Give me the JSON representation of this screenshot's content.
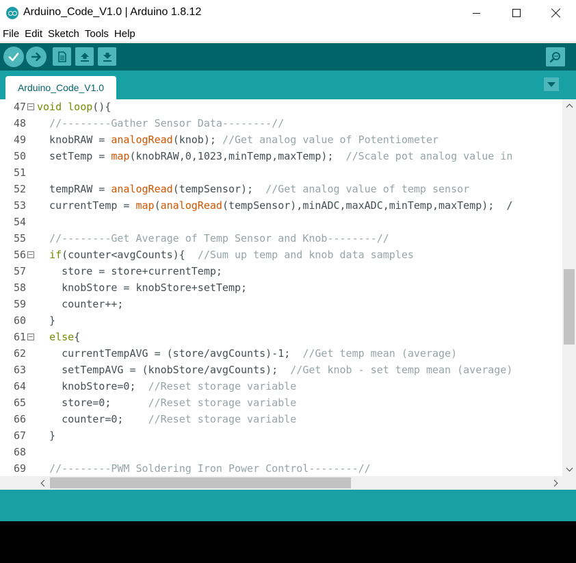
{
  "window": {
    "title": "Arduino_Code_V1.0 | Arduino 1.8.12",
    "app_icon": "arduino-logo-icon"
  },
  "menu": [
    "File",
    "Edit",
    "Sketch",
    "Tools",
    "Help"
  ],
  "toolbar": {
    "buttons": [
      "verify-icon",
      "upload-icon",
      "new-icon",
      "open-icon",
      "save-icon"
    ],
    "right_button": "serial-monitor-icon"
  },
  "tabs": [
    {
      "label": "Arduino_Code_V1.0",
      "active": true
    }
  ],
  "colors": {
    "toolbar": "#006468",
    "tabbar": "#17a1a5",
    "button": "#4db7bb",
    "keyword": "#728e00",
    "function": "#d35400",
    "comment": "#95a5a6",
    "text": "#434f54"
  },
  "editor": {
    "lines": [
      {
        "n": "47",
        "fold": true,
        "tokens": [
          {
            "t": "void loop",
            "c": "kw"
          },
          {
            "t": "(){",
            "c": ""
          }
        ]
      },
      {
        "n": "48",
        "fold": false,
        "tokens": [
          {
            "t": "  ",
            "c": ""
          },
          {
            "t": "//--------Gather Sensor Data--------//",
            "c": "cm"
          }
        ]
      },
      {
        "n": "49",
        "fold": false,
        "tokens": [
          {
            "t": "  knobRAW = ",
            "c": ""
          },
          {
            "t": "analogRead",
            "c": "fn"
          },
          {
            "t": "(knob); ",
            "c": ""
          },
          {
            "t": "//Get analog value of Potentiometer",
            "c": "cm"
          }
        ]
      },
      {
        "n": "50",
        "fold": false,
        "tokens": [
          {
            "t": "  setTemp = ",
            "c": ""
          },
          {
            "t": "map",
            "c": "fn"
          },
          {
            "t": "(knobRAW,0,1023,minTemp,maxTemp);  ",
            "c": ""
          },
          {
            "t": "//Scale pot analog value in",
            "c": "cm"
          }
        ]
      },
      {
        "n": "51",
        "fold": false,
        "tokens": []
      },
      {
        "n": "52",
        "fold": false,
        "tokens": [
          {
            "t": "  tempRAW = ",
            "c": ""
          },
          {
            "t": "analogRead",
            "c": "fn"
          },
          {
            "t": "(tempSensor);  ",
            "c": ""
          },
          {
            "t": "//Get analog value of temp sensor",
            "c": "cm"
          }
        ]
      },
      {
        "n": "53",
        "fold": false,
        "tokens": [
          {
            "t": "  currentTemp = ",
            "c": ""
          },
          {
            "t": "map",
            "c": "fn"
          },
          {
            "t": "(",
            "c": ""
          },
          {
            "t": "analogRead",
            "c": "fn"
          },
          {
            "t": "(tempSensor),minADC,maxADC,minTemp,maxTemp);  /",
            "c": ""
          }
        ]
      },
      {
        "n": "54",
        "fold": false,
        "tokens": []
      },
      {
        "n": "55",
        "fold": false,
        "tokens": [
          {
            "t": "  ",
            "c": ""
          },
          {
            "t": "//--------Get Average of Temp Sensor and Knob--------//",
            "c": "cm"
          }
        ]
      },
      {
        "n": "56",
        "fold": true,
        "tokens": [
          {
            "t": "  ",
            "c": ""
          },
          {
            "t": "if",
            "c": "kw"
          },
          {
            "t": "(counter<avgCounts){  ",
            "c": ""
          },
          {
            "t": "//Sum up temp and knob data samples",
            "c": "cm"
          }
        ]
      },
      {
        "n": "57",
        "fold": false,
        "tokens": [
          {
            "t": "    store = store+currentTemp;",
            "c": ""
          }
        ]
      },
      {
        "n": "58",
        "fold": false,
        "tokens": [
          {
            "t": "    knobStore = knobStore+setTemp;",
            "c": ""
          }
        ]
      },
      {
        "n": "59",
        "fold": false,
        "tokens": [
          {
            "t": "    counter++;",
            "c": ""
          }
        ]
      },
      {
        "n": "60",
        "fold": false,
        "tokens": [
          {
            "t": "  }",
            "c": ""
          }
        ]
      },
      {
        "n": "61",
        "fold": true,
        "tokens": [
          {
            "t": "  ",
            "c": ""
          },
          {
            "t": "else",
            "c": "kw"
          },
          {
            "t": "{",
            "c": ""
          }
        ]
      },
      {
        "n": "62",
        "fold": false,
        "tokens": [
          {
            "t": "    currentTempAVG = (store/avgCounts)-1;  ",
            "c": ""
          },
          {
            "t": "//Get temp mean (average)",
            "c": "cm"
          }
        ]
      },
      {
        "n": "63",
        "fold": false,
        "tokens": [
          {
            "t": "    setTempAVG = (knobStore/avgCounts);  ",
            "c": ""
          },
          {
            "t": "//Get knob - set temp mean (average)",
            "c": "cm"
          }
        ]
      },
      {
        "n": "64",
        "fold": false,
        "tokens": [
          {
            "t": "    knobStore=0;  ",
            "c": ""
          },
          {
            "t": "//Reset storage variable",
            "c": "cm"
          }
        ]
      },
      {
        "n": "65",
        "fold": false,
        "tokens": [
          {
            "t": "    store=0;      ",
            "c": ""
          },
          {
            "t": "//Reset storage variable",
            "c": "cm"
          }
        ]
      },
      {
        "n": "66",
        "fold": false,
        "tokens": [
          {
            "t": "    counter=0;    ",
            "c": ""
          },
          {
            "t": "//Reset storage variable",
            "c": "cm"
          }
        ]
      },
      {
        "n": "67",
        "fold": false,
        "tokens": [
          {
            "t": "  }",
            "c": ""
          }
        ]
      },
      {
        "n": "68",
        "fold": false,
        "tokens": []
      },
      {
        "n": "69",
        "fold": false,
        "tokens": [
          {
            "t": "  ",
            "c": ""
          },
          {
            "t": "//--------PWM Soldering Iron Power Control--------//",
            "c": "cm"
          }
        ]
      }
    ]
  }
}
